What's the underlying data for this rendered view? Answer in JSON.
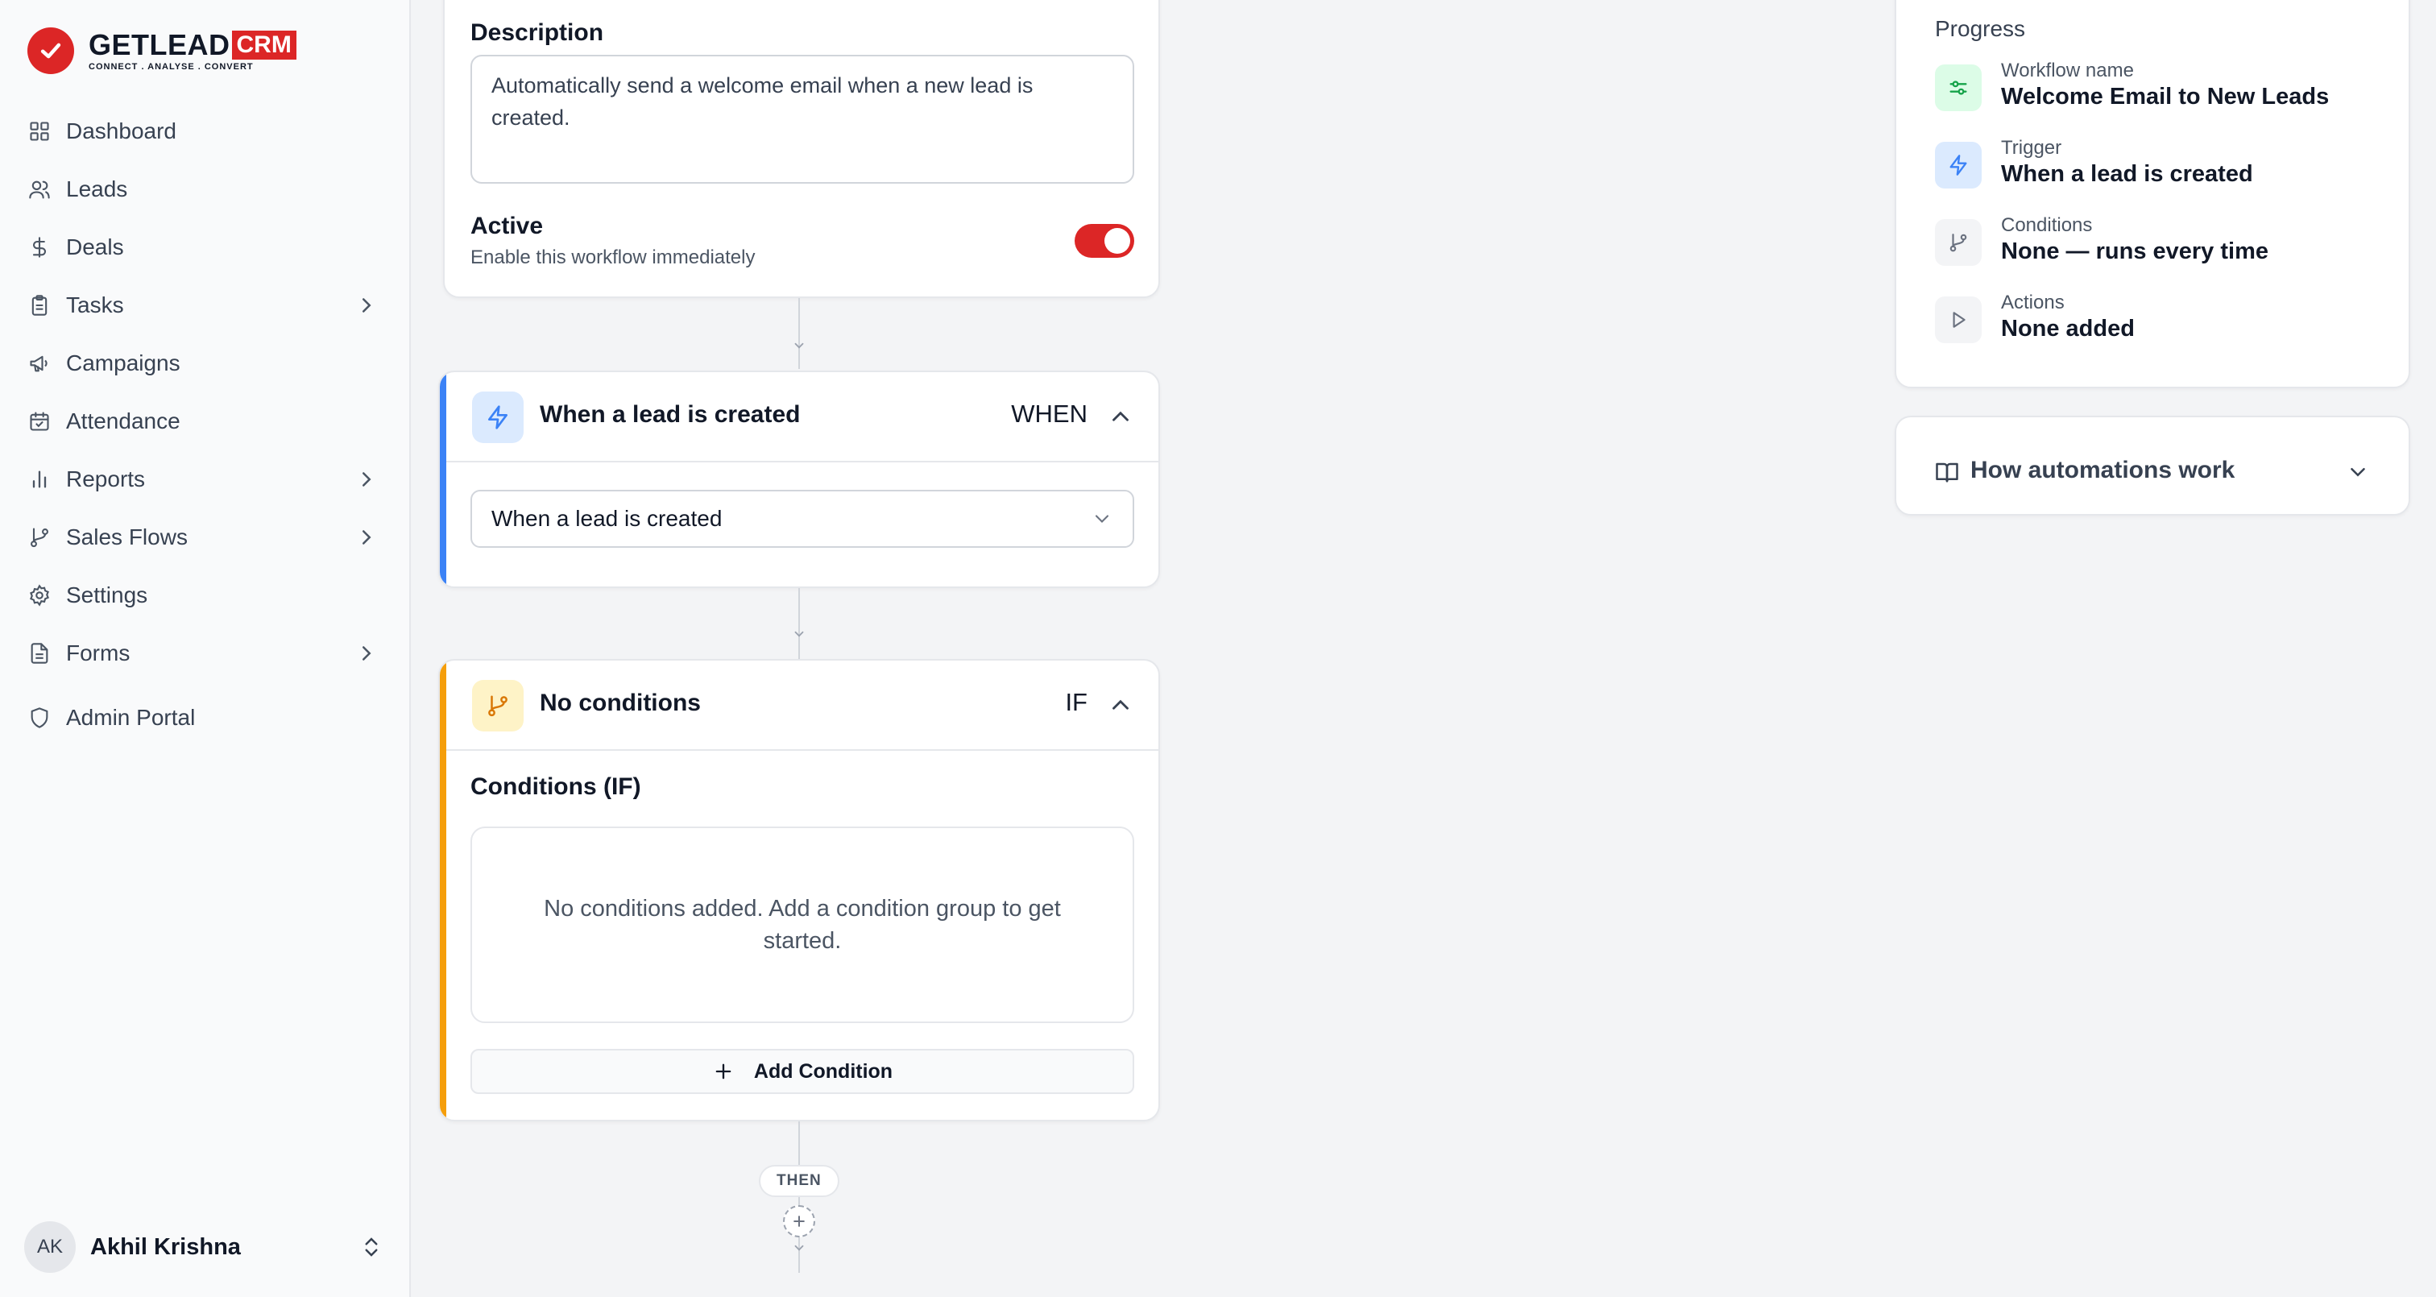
{
  "brand": {
    "name": "GETLEAD",
    "badge": "CRM",
    "tagline": "CONNECT . ANALYSE . CONVERT",
    "accent": "#dc2626"
  },
  "sidebar": {
    "items": [
      {
        "label": "Dashboard",
        "icon": "grid-icon",
        "has_submenu": false
      },
      {
        "label": "Leads",
        "icon": "users-icon",
        "has_submenu": false
      },
      {
        "label": "Deals",
        "icon": "dollar-icon",
        "has_submenu": false
      },
      {
        "label": "Tasks",
        "icon": "clipboard-icon",
        "has_submenu": true
      },
      {
        "label": "Campaigns",
        "icon": "megaphone-icon",
        "has_submenu": false
      },
      {
        "label": "Attendance",
        "icon": "calendar-check-icon",
        "has_submenu": false
      },
      {
        "label": "Reports",
        "icon": "bar-chart-icon",
        "has_submenu": true
      },
      {
        "label": "Sales Flows",
        "icon": "git-branch-icon",
        "has_submenu": true
      },
      {
        "label": "Settings",
        "icon": "gear-icon",
        "has_submenu": false
      },
      {
        "label": "Forms",
        "icon": "file-text-icon",
        "has_submenu": true
      },
      {
        "label": "Admin Portal",
        "icon": "shield-icon",
        "has_submenu": false
      }
    ],
    "user": {
      "initials": "AK",
      "name": "Akhil Krishna"
    }
  },
  "details": {
    "description_label": "Description",
    "description_value": "Automatically send a welcome email when a new lead is created.",
    "active_label": "Active",
    "active_hint": "Enable this workflow immediately",
    "active": true
  },
  "trigger_step": {
    "title": "When a lead is created",
    "tag": "WHEN",
    "accent": "#3b82f6",
    "selected": "When a lead is created"
  },
  "condition_step": {
    "title": "No conditions",
    "tag": "IF",
    "accent": "#f59e0b",
    "section_label": "Conditions (IF)",
    "empty_text": "No conditions added. Add a condition group to get started.",
    "add_label": "Add Condition"
  },
  "flow": {
    "then_label": "THEN"
  },
  "progress": {
    "title": "Progress",
    "items": [
      {
        "label": "Workflow name",
        "value": "Welcome Email to New Leads",
        "icon": "sliders-icon",
        "color": "#16a34a"
      },
      {
        "label": "Trigger",
        "value": "When a lead is created",
        "icon": "bolt-icon",
        "color": "#3b82f6"
      },
      {
        "label": "Conditions",
        "value": "None — runs every time",
        "icon": "git-branch-icon",
        "color": "#6b7280"
      },
      {
        "label": "Actions",
        "value": "None added",
        "icon": "play-icon",
        "color": "#6b7280"
      }
    ]
  },
  "help": {
    "title": "How automations work"
  }
}
